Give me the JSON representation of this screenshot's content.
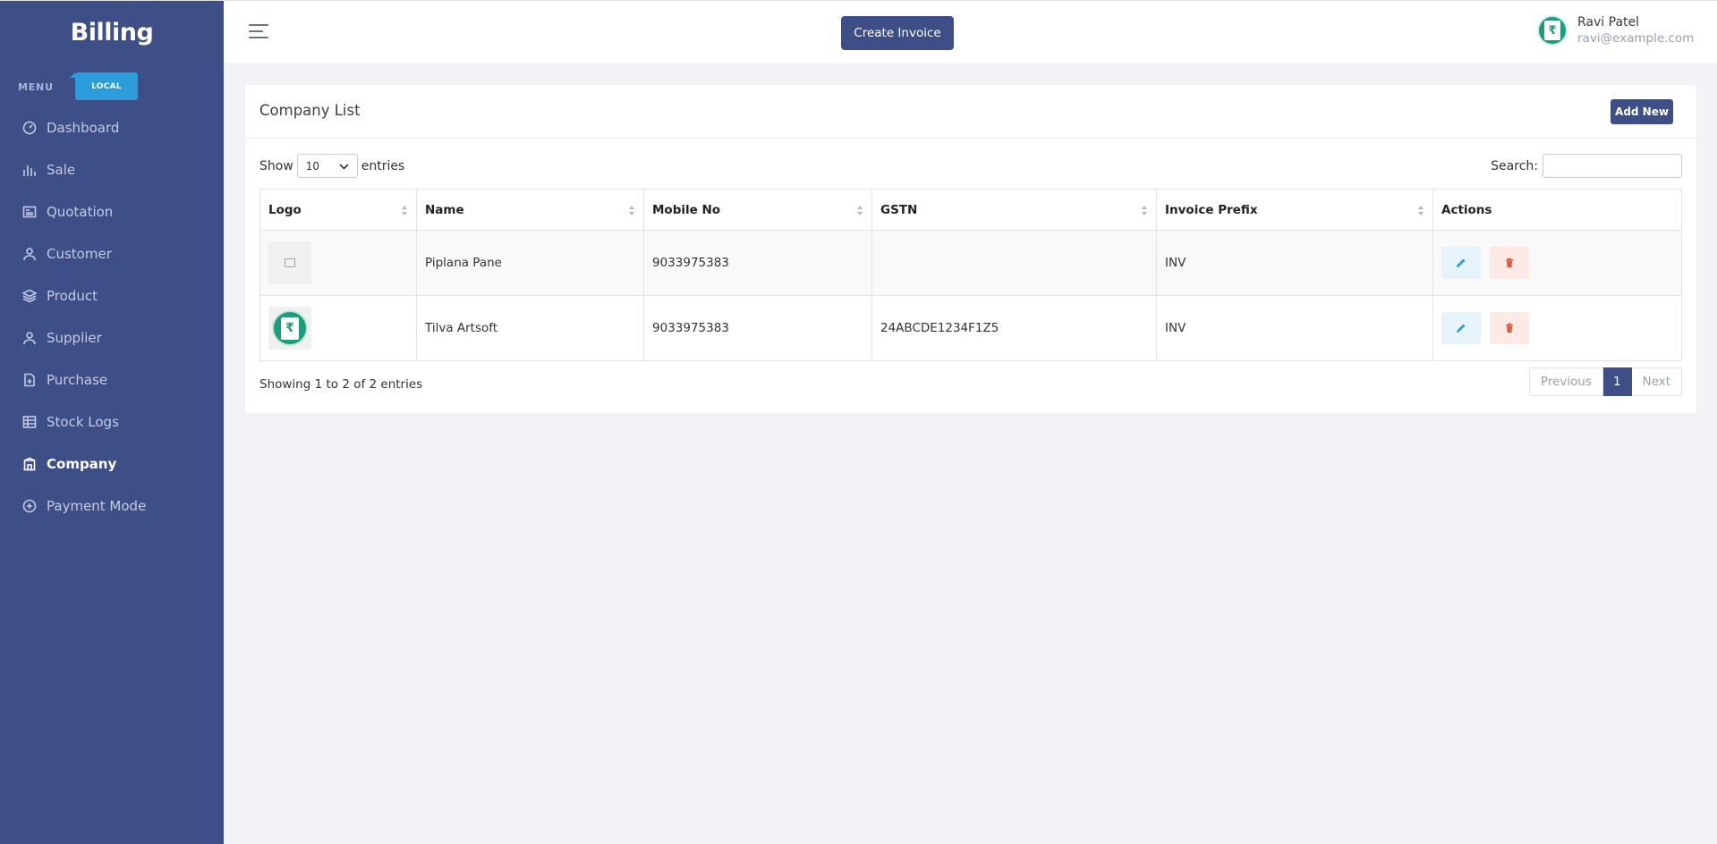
{
  "sidebar": {
    "brand": "Billing",
    "menu_label": "MENU",
    "badge": "LOCAL",
    "items": [
      {
        "label": "Dashboard",
        "icon": "dashboard-icon"
      },
      {
        "label": "Sale",
        "icon": "bar-chart-icon"
      },
      {
        "label": "Quotation",
        "icon": "newspaper-icon"
      },
      {
        "label": "Customer",
        "icon": "user-icon"
      },
      {
        "label": "Product",
        "icon": "layers-icon"
      },
      {
        "label": "Supplier",
        "icon": "user-icon"
      },
      {
        "label": "Purchase",
        "icon": "file-plus-icon"
      },
      {
        "label": "Stock Logs",
        "icon": "table-icon"
      },
      {
        "label": "Company",
        "icon": "building-icon",
        "active": true
      },
      {
        "label": "Payment Mode",
        "icon": "wallet-icon"
      }
    ]
  },
  "topbar": {
    "create_invoice": "Create Invoice",
    "user": {
      "name": "Ravi Patel",
      "email": "ravi@example.com",
      "avatar_symbol": "₹"
    }
  },
  "card": {
    "title": "Company List",
    "add_new": "Add New",
    "show_label": "Show",
    "entries_value": "10",
    "entries_label": "entries",
    "search_label": "Search:",
    "columns": [
      "Logo",
      "Name",
      "Mobile No",
      "GSTN",
      "Invoice Prefix",
      "Actions"
    ],
    "rows": [
      {
        "logo": "placeholder-image",
        "name": "Piplana Pane",
        "mobile": "9033975383",
        "gstn": "",
        "prefix": "INV"
      },
      {
        "logo": "rupee-doc-logo",
        "logo_symbol": "₹",
        "name": "Tilva Artsoft",
        "mobile": "9033975383",
        "gstn": "24ABCDE1234F1Z5",
        "prefix": "INV"
      }
    ],
    "info": "Showing 1 to 2 of 2 entries",
    "pagination": {
      "previous": "Previous",
      "current": "1",
      "next": "Next"
    }
  },
  "colors": {
    "primary": "#3e4f87",
    "badge": "#2d9cdb",
    "logo_green": "#1d9c7b",
    "edit_icon": "#2d9cdb",
    "delete_icon": "#e55b3c"
  }
}
